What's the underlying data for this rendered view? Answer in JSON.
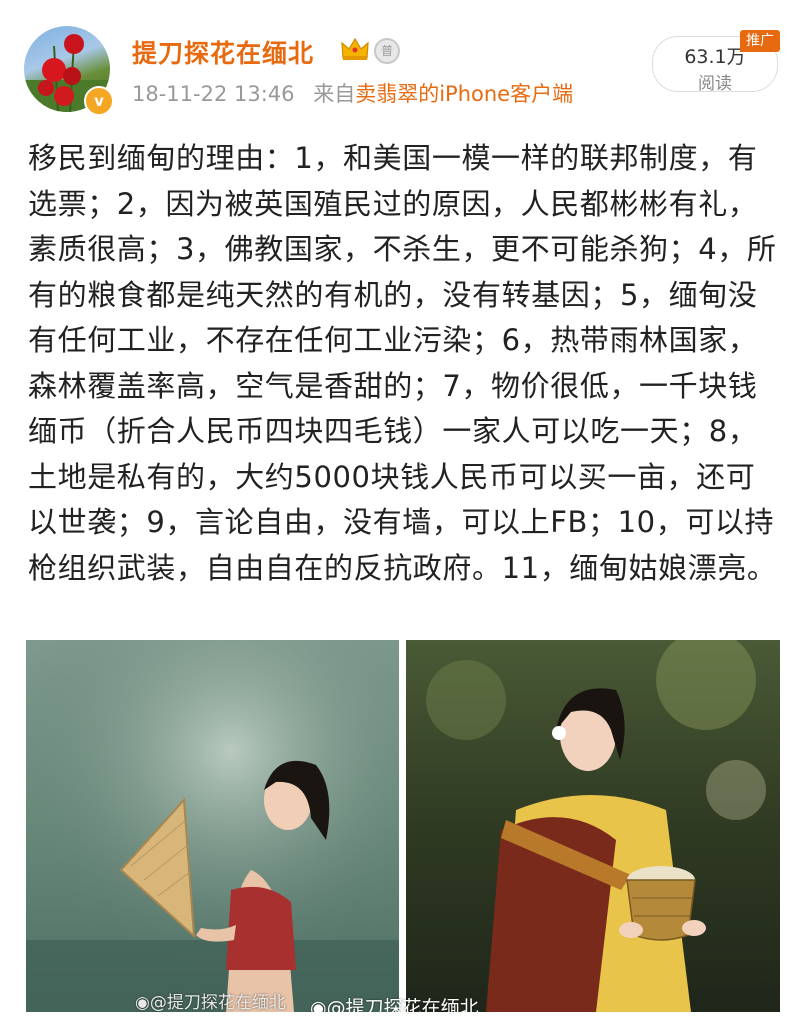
{
  "post": {
    "author": "提刀探花在缅北",
    "verify_mark": "v",
    "medal_glyph": "普",
    "timestamp": "18-11-22 13:46",
    "source_prefix": "来自",
    "source_name": "卖翡翠的iPhone客户端",
    "read_count": "63.1万",
    "read_label": "阅读",
    "promo_label": "推广",
    "body": "移民到缅甸的理由：1，和美国一模一样的联邦制度，有选票；2，因为被英国殖民过的原因，人民都彬彬有礼，素质很高；3，佛教国家，不杀生，更不可能杀狗；4，所有的粮食都是纯天然的有机的，没有转基因；5，缅甸没有任何工业，不存在任何工业污染；6，热带雨林国家，森林覆盖率高，空气是香甜的；7，物价很低，一千块钱缅币（折合人民币四块四毛钱）一家人可以吃一天；8，土地是私有的，大约5000块钱人民币可以买一亩，还可以世袭；9，言论自由，没有墙，可以上FB；10，可以持枪组织武装，自由自在的反抗政府。11，缅甸姑娘漂亮。"
  },
  "images": {
    "watermark_left": "@提刀探花在缅北",
    "watermark_right": "@提刀探花在缅北"
  },
  "icons": {
    "crown": "crown-icon",
    "medal": "medal-icon",
    "verified": "verified-badge-icon",
    "weibo": "weibo-logo-icon"
  },
  "colors": {
    "username": "#e86a10",
    "promo": "#e86a10",
    "meta": "#999999"
  }
}
